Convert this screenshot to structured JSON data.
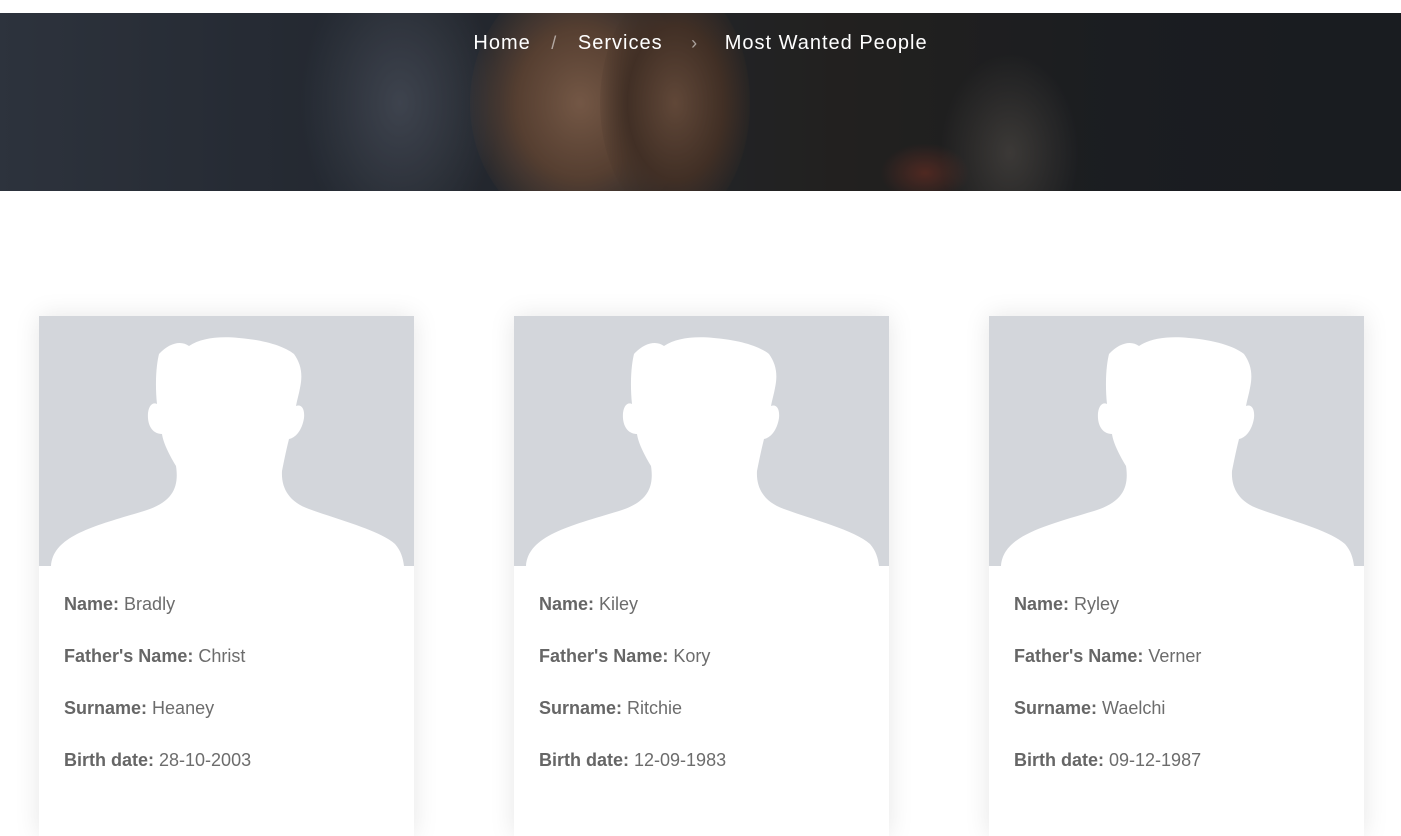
{
  "breadcrumb": {
    "home": "Home",
    "separator1": "/",
    "services": "Services",
    "separator2": "›",
    "current": "Most Wanted People"
  },
  "labels": {
    "name": "Name:",
    "father": "Father's Name:",
    "surname": "Surname:",
    "birth": "Birth date:"
  },
  "people": [
    {
      "name": "Bradly",
      "father": "Christ",
      "surname": "Heaney",
      "birth": "28-10-2003"
    },
    {
      "name": "Kiley",
      "father": "Kory",
      "surname": "Ritchie",
      "birth": "12-09-1983"
    },
    {
      "name": "Ryley",
      "father": "Verner",
      "surname": "Waelchi",
      "birth": "09-12-1987"
    }
  ],
  "colors": {
    "photo_background": "#d3d6db",
    "label_text": "#666666",
    "value_text": "#6c6c6c"
  },
  "icons": {
    "avatar": "person-silhouette-icon"
  }
}
